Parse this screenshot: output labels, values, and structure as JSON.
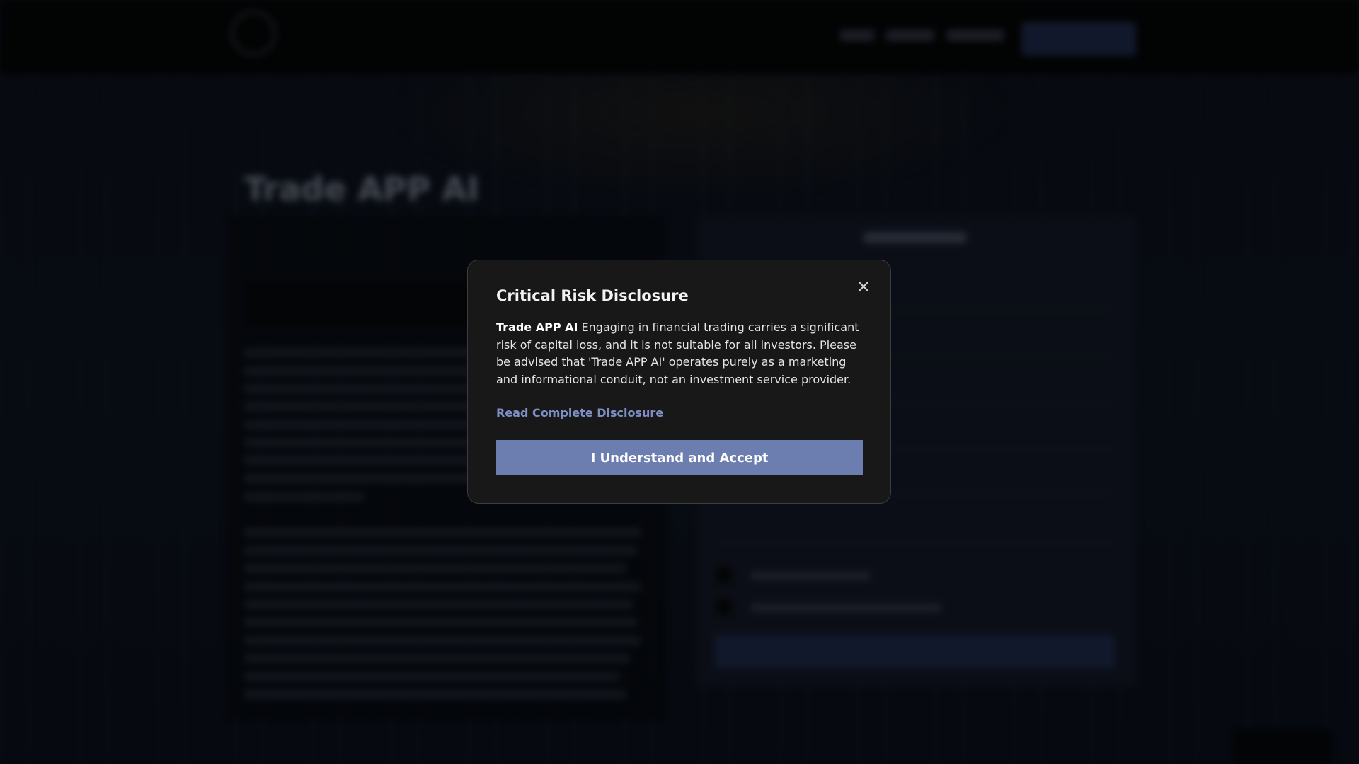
{
  "site": {
    "hero_title": "Trade APP AI"
  },
  "modal": {
    "title": "Critical Risk Disclosure",
    "body_brand": "Trade APP AI",
    "body_text": " Engaging in financial trading carries a significant risk of capital loss, and it is not suitable for all investors. Please be advised that 'Trade APP AI' operates purely as a marketing and informational conduit, not an investment service provider.",
    "link_label": "Read Complete Disclosure",
    "accept_label": "I Understand and Accept",
    "close_icon": "close-icon"
  },
  "colors": {
    "modal_bg": "#181818",
    "accent_button": "#6c7db0",
    "link": "#7d8fc4",
    "overlay": "rgba(0,0,0,0.35)"
  }
}
